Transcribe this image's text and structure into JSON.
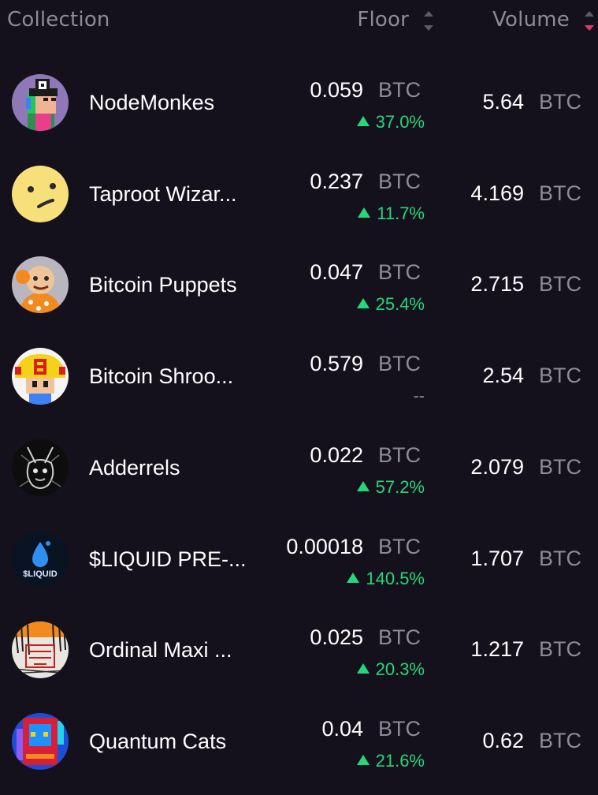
{
  "header": {
    "collection_label": "Collection",
    "floor_label": "Floor",
    "volume_label": "Volume"
  },
  "colors": {
    "background": "#14111c",
    "muted": "#8e8a99",
    "positive": "#26d67a",
    "sort_active": "#e5386f"
  },
  "rows": [
    {
      "name": "NodeMonkes",
      "floor": "0.059",
      "floor_unit": "BTC",
      "change": "37.0%",
      "volume": "5.64",
      "volume_unit": "BTC",
      "icon": "nodemonkes-avatar-icon"
    },
    {
      "name": "Taproot Wizar...",
      "floor": "0.237",
      "floor_unit": "BTC",
      "change": "11.7%",
      "volume": "4.169",
      "volume_unit": "BTC",
      "icon": "taproot-wizards-avatar-icon"
    },
    {
      "name": "Bitcoin Puppets",
      "floor": "0.047",
      "floor_unit": "BTC",
      "change": "25.4%",
      "volume": "2.715",
      "volume_unit": "BTC",
      "icon": "bitcoin-puppets-avatar-icon"
    },
    {
      "name": "Bitcoin Shroo...",
      "floor": "0.579",
      "floor_unit": "BTC",
      "change": "--",
      "volume": "2.54",
      "volume_unit": "BTC",
      "icon": "bitcoin-shrooms-avatar-icon"
    },
    {
      "name": "Adderrels",
      "floor": "0.022",
      "floor_unit": "BTC",
      "change": "57.2%",
      "volume": "2.079",
      "volume_unit": "BTC",
      "icon": "adderrels-avatar-icon"
    },
    {
      "name": "$LIQUID PRE-...",
      "floor": "0.00018",
      "floor_unit": "BTC",
      "change": "140.5%",
      "volume": "1.707",
      "volume_unit": "BTC",
      "icon": "liquid-avatar-icon",
      "avatar_text": "$LIQUID"
    },
    {
      "name": "Ordinal Maxi ...",
      "floor": "0.025",
      "floor_unit": "BTC",
      "change": "20.3%",
      "volume": "1.217",
      "volume_unit": "BTC",
      "icon": "ordinal-maxi-biz-avatar-icon"
    },
    {
      "name": "Quantum Cats",
      "floor": "0.04",
      "floor_unit": "BTC",
      "change": "21.6%",
      "volume": "0.62",
      "volume_unit": "BTC",
      "icon": "quantum-cats-avatar-icon"
    }
  ]
}
